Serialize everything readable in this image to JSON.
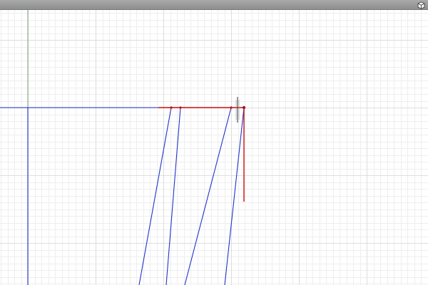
{
  "app": {
    "view": "sketch-canvas"
  },
  "toolbar": {
    "view_cube_icon": "view-cube-icon"
  },
  "colors": {
    "background": "#ffffff",
    "grid_minor": "#eeeeee",
    "grid_major": "#dddddd",
    "axis_green": "#7aa57a",
    "sketch_blue": "#2233cc",
    "selected_red": "#cc1111",
    "titlebar": "#9a9a9a"
  }
}
